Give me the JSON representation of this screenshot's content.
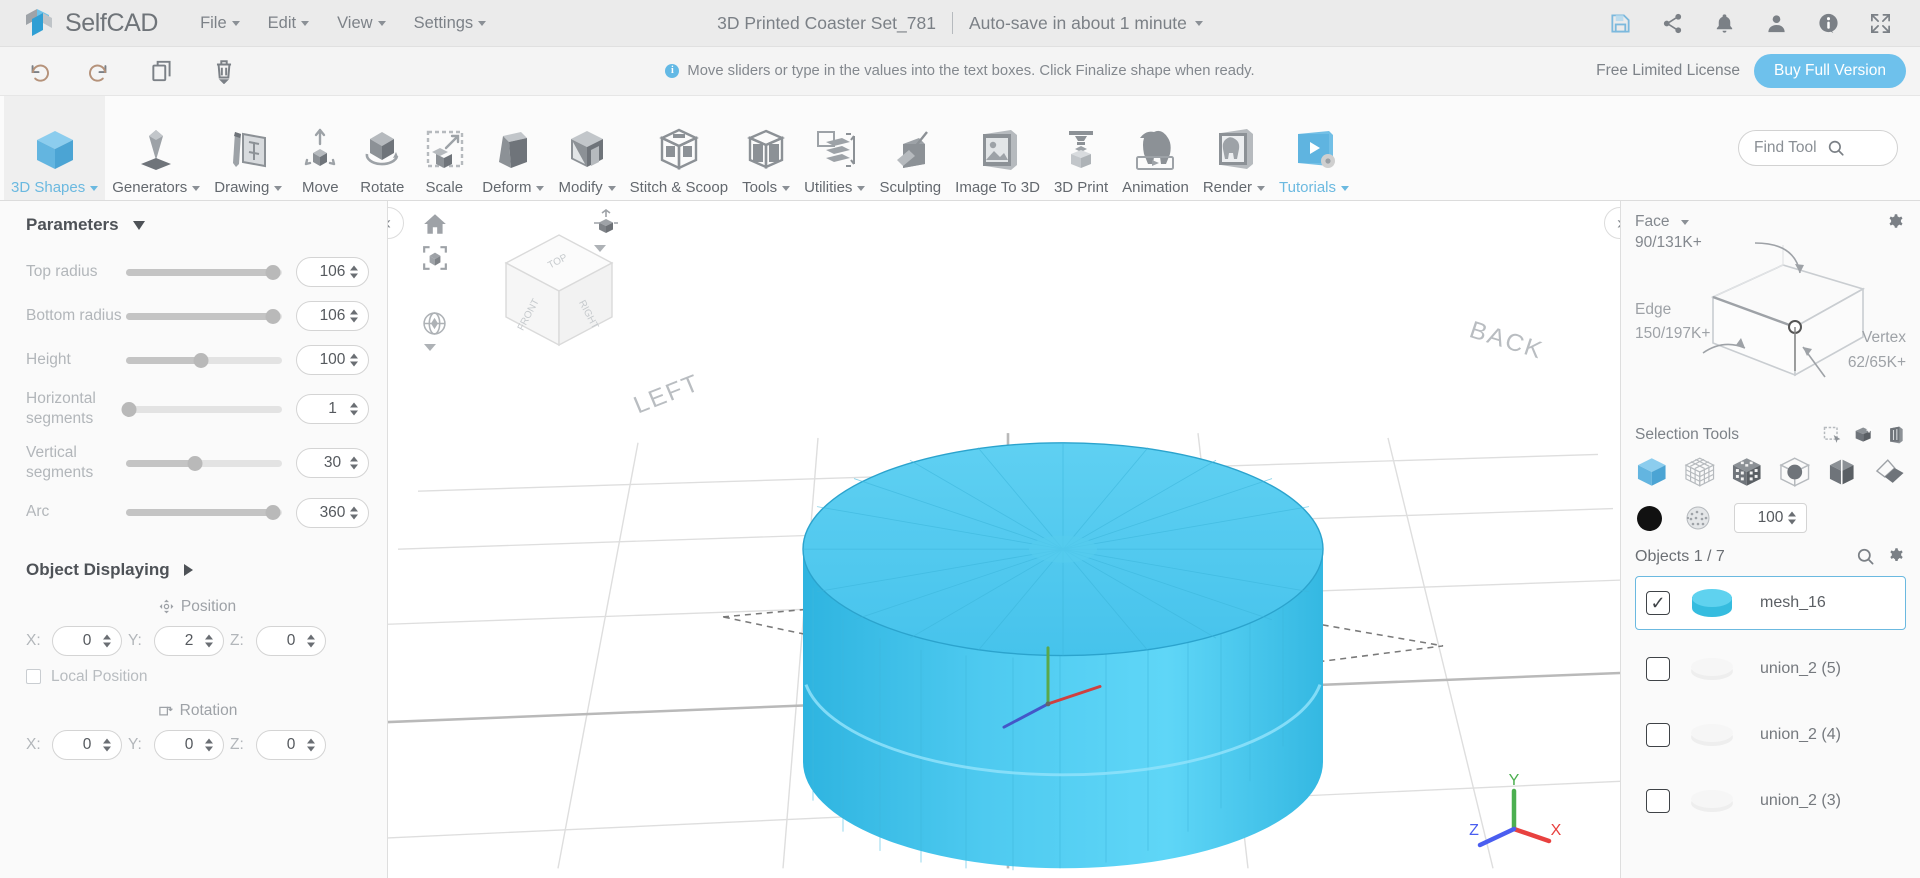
{
  "menubar": {
    "brand": "SelfCAD",
    "items": [
      {
        "label": "File",
        "caret": true
      },
      {
        "label": "Edit",
        "caret": true
      },
      {
        "label": "View",
        "caret": true
      },
      {
        "label": "Settings",
        "caret": true
      }
    ],
    "document_title": "3D Printed Coaster Set_781",
    "autosave": "Auto-save in about 1 minute",
    "icons": [
      "save-icon",
      "share-icon",
      "bell-icon",
      "account-icon",
      "info-icon",
      "fullscreen-icon"
    ],
    "accent": "#6bb9e0"
  },
  "actionbar": {
    "buttons": [
      "undo-icon",
      "redo-icon",
      "copy-icon",
      "delete-icon"
    ],
    "hint": "Move sliders or type in the values into the text boxes. Click Finalize shape when ready.",
    "hint_badge": "i",
    "license_text": "Free Limited License",
    "buy_label": "Buy Full Version"
  },
  "ribbon": {
    "tools": [
      {
        "label": "3D Shapes",
        "icon": "cube-icon",
        "caret": true,
        "active": true,
        "accent": true
      },
      {
        "label": "Generators",
        "icon": "generator-icon",
        "caret": true,
        "active": false,
        "accent": false
      },
      {
        "label": "Drawing",
        "icon": "drawing-icon",
        "caret": true,
        "active": false,
        "accent": false
      },
      {
        "label": "Move",
        "icon": "move-icon",
        "caret": false,
        "active": false,
        "accent": false
      },
      {
        "label": "Rotate",
        "icon": "rotate-icon",
        "caret": false,
        "active": false,
        "accent": false
      },
      {
        "label": "Scale",
        "icon": "scale-icon",
        "caret": false,
        "active": false,
        "accent": false
      },
      {
        "label": "Deform",
        "icon": "deform-icon",
        "caret": true,
        "active": false,
        "accent": false
      },
      {
        "label": "Modify",
        "icon": "modify-icon",
        "caret": true,
        "active": false,
        "accent": false
      },
      {
        "label": "Stitch & Scoop",
        "icon": "stitch-scoop-icon",
        "caret": false,
        "active": false,
        "accent": false
      },
      {
        "label": "Tools",
        "icon": "tools-icon",
        "caret": true,
        "active": false,
        "accent": false
      },
      {
        "label": "Utilities",
        "icon": "utilities-icon",
        "caret": true,
        "active": false,
        "accent": false
      },
      {
        "label": "Sculpting",
        "icon": "sculpting-icon",
        "caret": false,
        "active": false,
        "accent": false
      },
      {
        "label": "Image To 3D",
        "icon": "image-to-3d-icon",
        "caret": false,
        "active": false,
        "accent": false
      },
      {
        "label": "3D Print",
        "icon": "3d-print-icon",
        "caret": false,
        "active": false,
        "accent": false
      },
      {
        "label": "Animation",
        "icon": "animation-icon",
        "caret": false,
        "active": false,
        "accent": false
      },
      {
        "label": "Render",
        "icon": "render-icon",
        "caret": true,
        "active": false,
        "accent": false
      },
      {
        "label": "Tutorials",
        "icon": "tutorials-icon",
        "caret": true,
        "active": false,
        "accent": true
      }
    ],
    "find_tool_label": "Find Tool",
    "find_tool_icon": "search-icon"
  },
  "parameters_panel": {
    "title": "Parameters",
    "collapse_icon": "triangle-down-icon",
    "rows": [
      {
        "label": "Top radius",
        "value": "106",
        "fill_pct": 94
      },
      {
        "label": "Bottom radius",
        "value": "106",
        "fill_pct": 94
      },
      {
        "label": "Height",
        "value": "100",
        "fill_pct": 48
      },
      {
        "label": "Horizontal segments",
        "value": "1",
        "fill_pct": 2
      },
      {
        "label": "Vertical segments",
        "value": "30",
        "fill_pct": 44
      },
      {
        "label": "Arc",
        "value": "360",
        "fill_pct": 94
      }
    ],
    "object_displaying": {
      "title": "Object Displaying",
      "expand_icon": "triangle-right-icon"
    },
    "position": {
      "title": "Position",
      "icon": "move-cross-icon",
      "x_label": "X:",
      "x_value": "0",
      "y_label": "Y:",
      "y_value": "2",
      "z_label": "Z:",
      "z_value": "0"
    },
    "local_position": {
      "label": "Local Position",
      "checked": false
    },
    "rotation": {
      "title": "Rotation",
      "icon": "rotate-box-icon",
      "x_label": "X:",
      "x_value": "0",
      "y_label": "Y:",
      "y_value": "0",
      "z_label": "Z:",
      "z_value": "0"
    }
  },
  "viewport": {
    "collapse_left_icon": "chevron-left-icon",
    "collapse_right_icon": "chevron-right-icon",
    "tools": [
      "home-icon",
      "fit-to-view-icon",
      "orbit-icon"
    ],
    "perspective_icon": "perspective-cube-icon",
    "navcube_faces": {
      "top": "TOP",
      "front": "FRONT",
      "right": "RIGHT"
    },
    "scene_labels": {
      "left": "LEFT",
      "back": "BACK"
    },
    "axis": {
      "x_label": "X",
      "x_color": "#e8413f",
      "y_label": "Y",
      "y_color": "#4caf50",
      "z_label": "Z",
      "z_color": "#4a5ef0"
    },
    "model_color": "#4ec9ef"
  },
  "right_panel": {
    "selection": {
      "mode_label": "Face",
      "mode_caret_icon": "caret-down-icon",
      "face_count": "90/131K+",
      "edge_label": "Edge",
      "edge_count": "150/197K+",
      "vertex_label": "Vertex",
      "vertex_count": "62/65K+",
      "settings_icon": "gear-icon"
    },
    "selection_tools": {
      "title": "Selection Tools",
      "top_icons": [
        "rect-select-icon",
        "add-select-icon",
        "through-select-icon"
      ],
      "mode_icons": [
        "object-select-icon",
        "wireframe-select-icon",
        "region-select-icon",
        "sphere-select-icon",
        "half-select-icon",
        "surface-select-icon"
      ],
      "selected_mode_index": 0,
      "swatch_icon": "color-swatch-icon",
      "texture_icon": "texture-sphere-icon",
      "opacity_value": "100"
    },
    "objects": {
      "title": "Objects 1 / 7",
      "search_icon": "search-icon",
      "settings_icon": "gear-icon",
      "items": [
        {
          "name": "mesh_16",
          "checked": true,
          "selected": true,
          "thumb": "cylinder-blue"
        },
        {
          "name": "union_2 (5)",
          "checked": false,
          "selected": false,
          "thumb": "disc-grey"
        },
        {
          "name": "union_2 (4)",
          "checked": false,
          "selected": false,
          "thumb": "disc-grey"
        },
        {
          "name": "union_2 (3)",
          "checked": false,
          "selected": false,
          "thumb": "disc-grey"
        }
      ]
    }
  }
}
